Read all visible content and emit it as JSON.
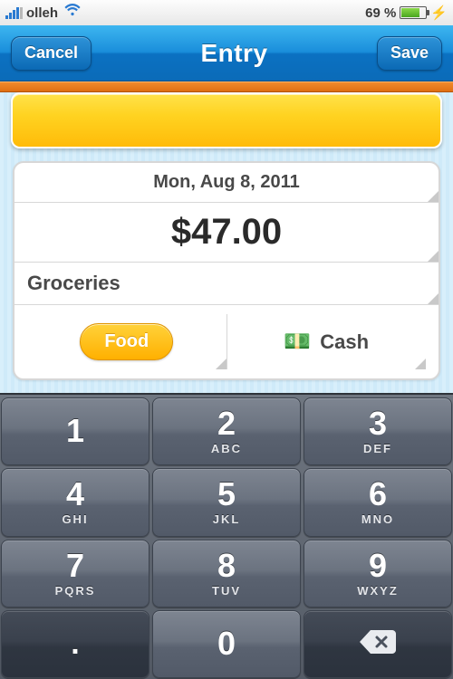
{
  "status": {
    "carrier": "olleh",
    "battery_pct": "69 %"
  },
  "nav": {
    "cancel": "Cancel",
    "title": "Entry",
    "save": "Save"
  },
  "entry": {
    "date": "Mon, Aug 8, 2011",
    "amount": "$47.00",
    "note": "Groceries",
    "category_pill": "Food",
    "payment_label": "Cash"
  },
  "keypad": {
    "k1": {
      "d": "1",
      "l": ""
    },
    "k2": {
      "d": "2",
      "l": "ABC"
    },
    "k3": {
      "d": "3",
      "l": "DEF"
    },
    "k4": {
      "d": "4",
      "l": "GHI"
    },
    "k5": {
      "d": "5",
      "l": "JKL"
    },
    "k6": {
      "d": "6",
      "l": "MNO"
    },
    "k7": {
      "d": "7",
      "l": "PQRS"
    },
    "k8": {
      "d": "8",
      "l": "TUV"
    },
    "k9": {
      "d": "9",
      "l": "WXYZ"
    },
    "k0": {
      "d": "0",
      "l": ""
    },
    "dot": {
      "d": ".",
      "l": ""
    }
  }
}
